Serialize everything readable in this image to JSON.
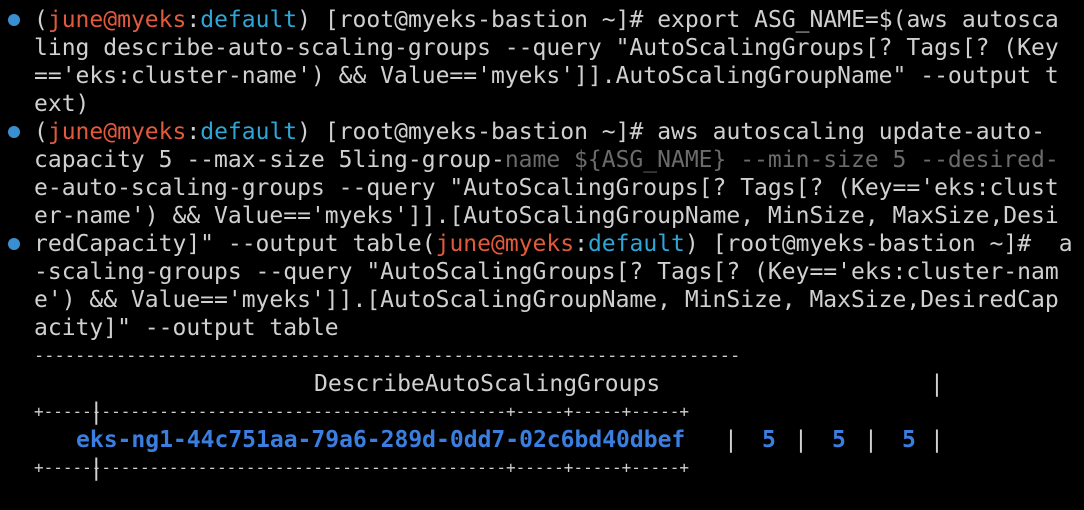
{
  "prompt": {
    "open": "(",
    "user": "june",
    "at": "@",
    "cluster": "myeks",
    "colon": ":",
    "namespace": "default",
    "close": ")",
    "bastion": " [root@myeks-bastion ~]# "
  },
  "cmd1": {
    "part1": "export ASG_NAME=$(aws autosca",
    "l2": "ling describe-auto-scaling-groups --query \"AutoScalingGroups[? Tags[? (Key",
    "l3": "=='eks:cluster-name') && Value=='myeks']].AutoScalingGroupName\" --output t",
    "l4": "ext)"
  },
  "cmd2": {
    "part1": "aws autoscaling update-auto-",
    "l2a": "capacity 5 --max-size 5ling-group-",
    "l2b": "name ${ASG_NAME} --min-size 5 --desired-",
    "l3": "e-auto-scaling-groups --query \"AutoScalingGroups[? Tags[? (Key=='eks:clust",
    "l4": "er-name') && Value=='myeks']].[AutoScalingGroupName, MinSize, MaxSize,Desi",
    "l5a": "redCapacity]\" --output table",
    "l5b": " a",
    "l6": "-scaling-groups --query \"AutoScalingGroups[? Tags[? (Key=='eks:cluster-nam",
    "l7": "e') && Value=='myeks']].[AutoScalingGroupName, MinSize, MaxSize,DesiredCap",
    "l8": "acity]\" --output table"
  },
  "table": {
    "top_border": "---------------------------------------------------------------------",
    "header_pipe_left": "|",
    "header_title": "DescribeAutoScalingGroups",
    "header_pipe_right": "|",
    "separator": "+------------------------------------------------+-----+-----+-----+",
    "row_pipe": "|",
    "asg_name": "eks-ng1-44c751aa-79a6-289d-0dd7-02c6bd40dbef",
    "min_size": "5",
    "max_size": "5",
    "desired": "5",
    "bottom_border": "+------------------------------------------------+-----+-----+-----+"
  }
}
